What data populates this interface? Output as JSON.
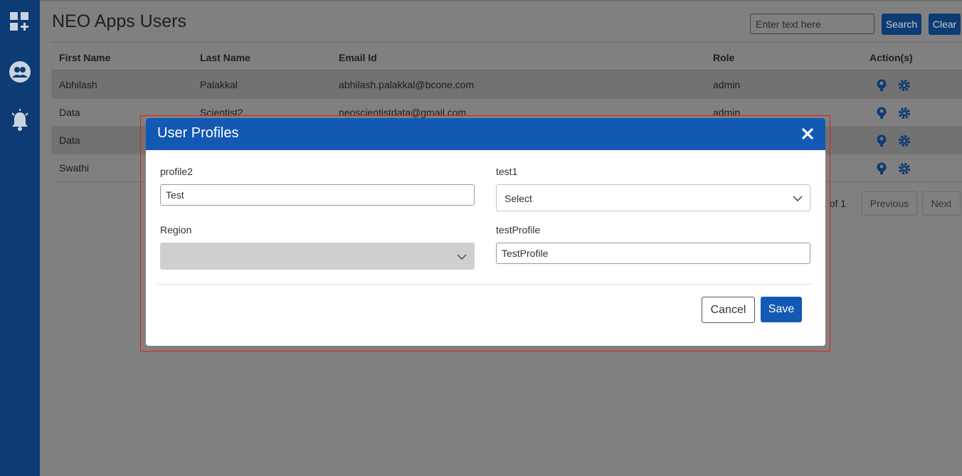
{
  "page": {
    "title": "NEO Apps Users",
    "search_placeholder": "Enter text here",
    "search_label": "Search",
    "clear_label": "Clear"
  },
  "table": {
    "headers": [
      "First Name",
      "Last Name",
      "Email Id",
      "Role",
      "Action(s)"
    ],
    "rows": [
      {
        "first": "Abhilash",
        "last": "Palakkal",
        "email": "abhilash.palakkal@bcone.com",
        "role": "admin"
      },
      {
        "first": "Data",
        "last": "Scientist2",
        "email": "neoscientistdata@gmail.com",
        "role": "admin"
      },
      {
        "first": "Data",
        "last": "",
        "email": "",
        "role": ""
      },
      {
        "first": "Swathi",
        "last": "",
        "email": "",
        "role": ""
      }
    ]
  },
  "pagination": {
    "info": "1 of 1",
    "previous_label": "Previous",
    "next_label": "Next"
  },
  "modal": {
    "title": "User Profiles",
    "fields": {
      "profile2": {
        "label": "profile2",
        "value": "Test"
      },
      "test1": {
        "label": "test1",
        "value": "Select"
      },
      "region": {
        "label": "Region",
        "value": ""
      },
      "testProfile": {
        "label": "testProfile",
        "value": "TestProfile"
      }
    },
    "cancel_label": "Cancel",
    "save_label": "Save"
  },
  "colors": {
    "sidebar": "#0d3b73",
    "modal_header": "#1359b3",
    "save_button": "#1359b3",
    "highlight_border": "#e0201f"
  },
  "icons": {
    "sidebar": [
      "apps-grid-icon",
      "users-group-icon",
      "notification-bell-icon"
    ],
    "row_actions": [
      "user-profile-icon",
      "settings-gear-icon"
    ],
    "modal": [
      "close-icon",
      "chevron-down-icon"
    ]
  }
}
